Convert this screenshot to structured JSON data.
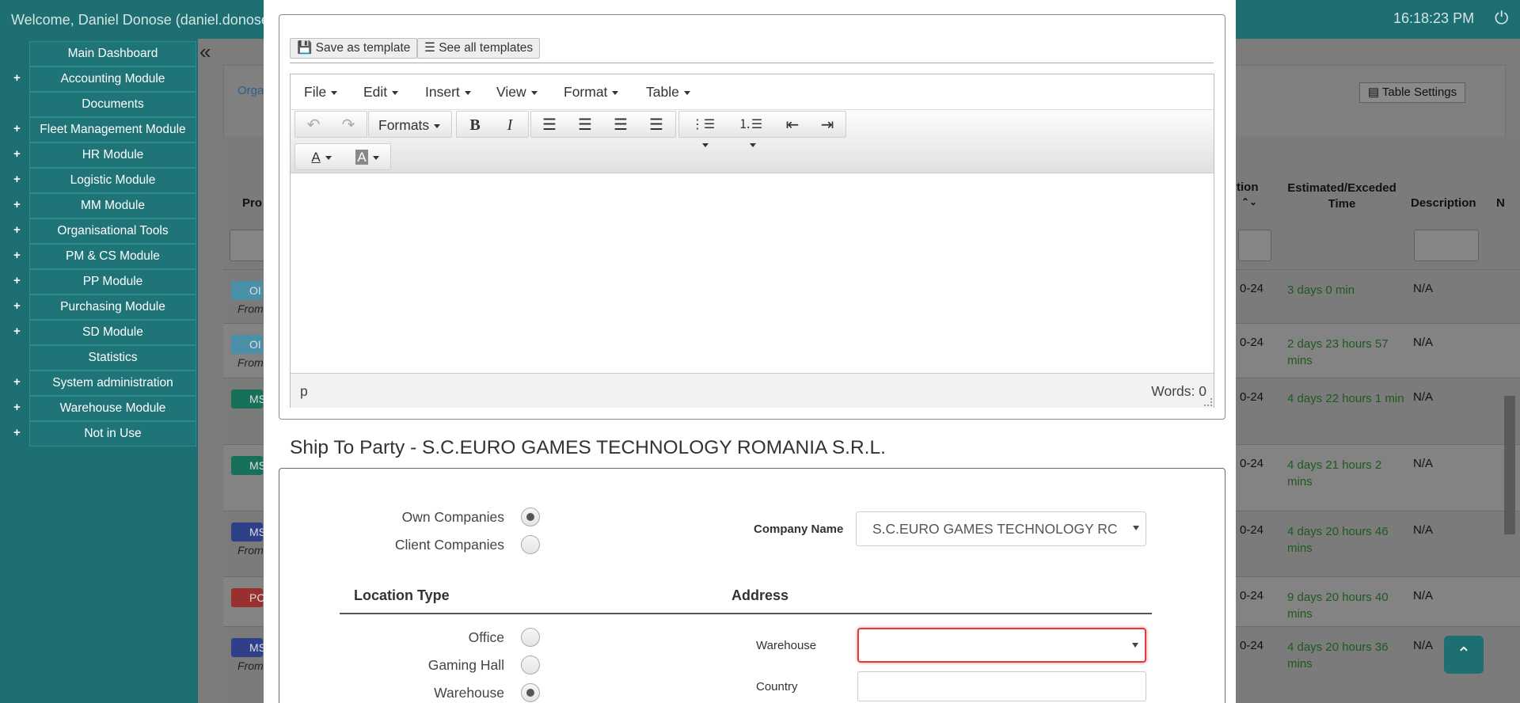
{
  "header": {
    "welcome": "Welcome, Daniel Donose (daniel.donose",
    "clock": "16:18:23 PM"
  },
  "sidebar": {
    "items": [
      {
        "label": "Main Dashboard",
        "expandable": false
      },
      {
        "label": "Accounting Module",
        "expandable": true
      },
      {
        "label": "Documents",
        "expandable": false
      },
      {
        "label": "Fleet Management Module",
        "expandable": true
      },
      {
        "label": "HR Module",
        "expandable": true
      },
      {
        "label": "Logistic Module",
        "expandable": true
      },
      {
        "label": "MM Module",
        "expandable": true
      },
      {
        "label": "Organisational Tools",
        "expandable": true
      },
      {
        "label": "PM & CS Module",
        "expandable": true
      },
      {
        "label": "PP Module",
        "expandable": true
      },
      {
        "label": "Purchasing Module",
        "expandable": true
      },
      {
        "label": "SD Module",
        "expandable": true
      },
      {
        "label": "Statistics",
        "expandable": false
      },
      {
        "label": "System administration",
        "expandable": true
      },
      {
        "label": "Warehouse Module",
        "expandable": true
      },
      {
        "label": "Not in Use",
        "expandable": true
      }
    ]
  },
  "background": {
    "orga_link": "Orga",
    "table_settings": "Table Settings",
    "headers": {
      "pro": "Pro",
      "tion": "tion",
      "estimated": "Estimated/Exceded Time",
      "description": "Description",
      "n": "N"
    },
    "rows": [
      {
        "tag": "OI",
        "tag_color": "#4a90a8",
        "from": "From",
        "date": "0-24",
        "time": "3 days 0 min",
        "desc": "N/A"
      },
      {
        "tag": "OI",
        "tag_color": "#4a90a8",
        "from": "From",
        "date": "0-24",
        "time": "2 days 23 hours 57 mins",
        "desc": "N/A"
      },
      {
        "tag": "MS",
        "tag_color": "#17705a",
        "from": "",
        "date": "0-24",
        "time": "4 days 22 hours 1 min",
        "desc": "N/A"
      },
      {
        "tag": "MS",
        "tag_color": "#17705a",
        "from": "",
        "date": "0-24",
        "time": "4 days 21 hours 2 mins",
        "desc": "N/A"
      },
      {
        "tag": "MS",
        "tag_color": "#2f3f8a",
        "from": "From",
        "date": "0-24",
        "time": "4 days 20 hours 46 mins",
        "desc": "N/A"
      },
      {
        "tag": "PC",
        "tag_color": "#9a2f2f",
        "from": "",
        "date": "0-24",
        "time": "9 days 20 hours 40 mins",
        "desc": "N/A"
      },
      {
        "tag": "MS",
        "tag_color": "#2f3f8a",
        "from": "From",
        "date": "0-24",
        "time": "4 days 20 hours 36 mins",
        "desc": "N/A"
      }
    ]
  },
  "templates": {
    "save_label": "Save as template",
    "see_label": "See all templates"
  },
  "editor": {
    "menus": [
      "File",
      "Edit",
      "Insert",
      "View",
      "Format",
      "Table"
    ],
    "formats_label": "Formats",
    "status_path": "p",
    "word_count": "Words: 0"
  },
  "ship": {
    "title": "Ship To Party - S.C.EURO GAMES TECHNOLOGY ROMANIA S.R.L.",
    "own_companies": "Own Companies",
    "client_companies": "Client Companies",
    "company_name_label": "Company Name",
    "company_name_value": "S.C.EURO GAMES TECHNOLOGY RC",
    "location_type_head": "Location Type",
    "address_head": "Address",
    "loc_office": "Office",
    "loc_gaming_hall": "Gaming Hall",
    "loc_warehouse": "Warehouse",
    "warehouse_label": "Warehouse",
    "warehouse_value": "",
    "country_label": "Country",
    "country_value": ""
  },
  "colors": {
    "brand": "#1e6f72",
    "error_border": "#e23b3b",
    "time_green": "#1e5a1e"
  }
}
